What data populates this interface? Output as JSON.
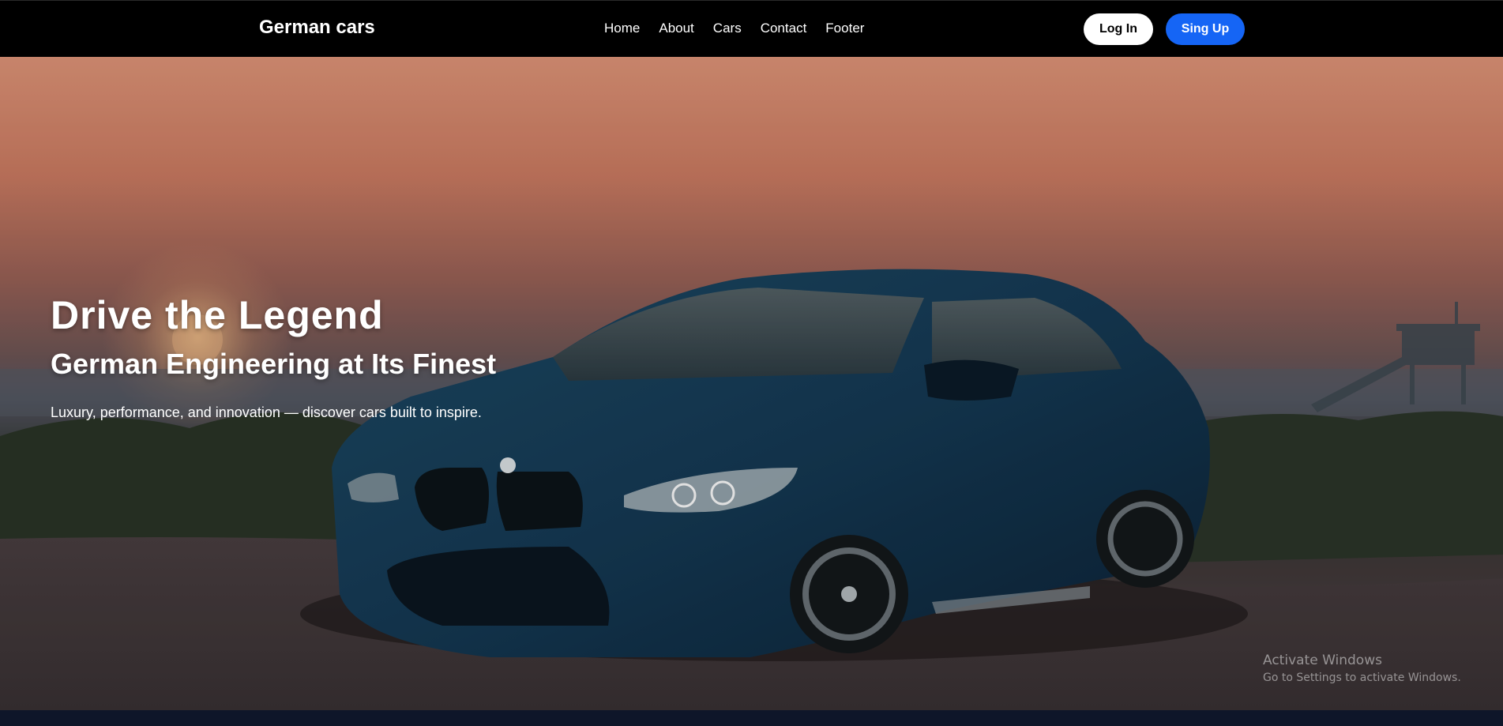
{
  "navbar": {
    "brand": "German cars",
    "links": [
      "Home",
      "About",
      "Cars",
      "Contact",
      "Footer"
    ],
    "login_label": "Log In",
    "signup_label": "Sing Up"
  },
  "hero": {
    "title": "Drive the Legend",
    "subtitle": "German Engineering at Its Finest",
    "tagline": "Luxury, performance, and innovation — discover cars built to inspire.",
    "image": "blue-bmw-coupe-at-sunset-beach"
  },
  "watermark": {
    "title": "Activate Windows",
    "subtitle": "Go to Settings to activate Windows."
  },
  "colors": {
    "navbar_bg": "#000000",
    "signup_bg": "#1565f5",
    "login_bg": "#ffffff",
    "footer_strip": "#0e1629"
  }
}
